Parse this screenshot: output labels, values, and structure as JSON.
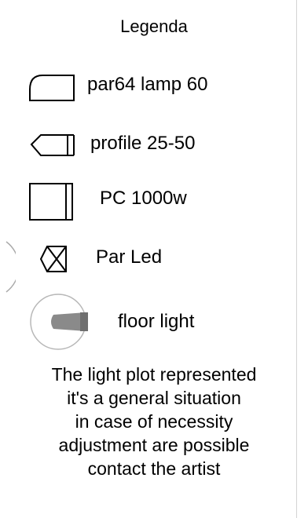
{
  "legend": {
    "title": "Legenda",
    "items": [
      {
        "icon": "par64-icon",
        "label": "par64  lamp 60"
      },
      {
        "icon": "profile-icon",
        "label": "profile 25-50"
      },
      {
        "icon": "pc-icon",
        "label": "PC 1000w"
      },
      {
        "icon": "par-led-icon",
        "label": "Par Led"
      },
      {
        "icon": "floor-light-icon",
        "label": "floor light"
      }
    ],
    "note_lines": [
      "The light plot represented",
      "it's a general situation",
      "in case of necessity",
      "adjustment are possible",
      "contact the artist"
    ]
  }
}
